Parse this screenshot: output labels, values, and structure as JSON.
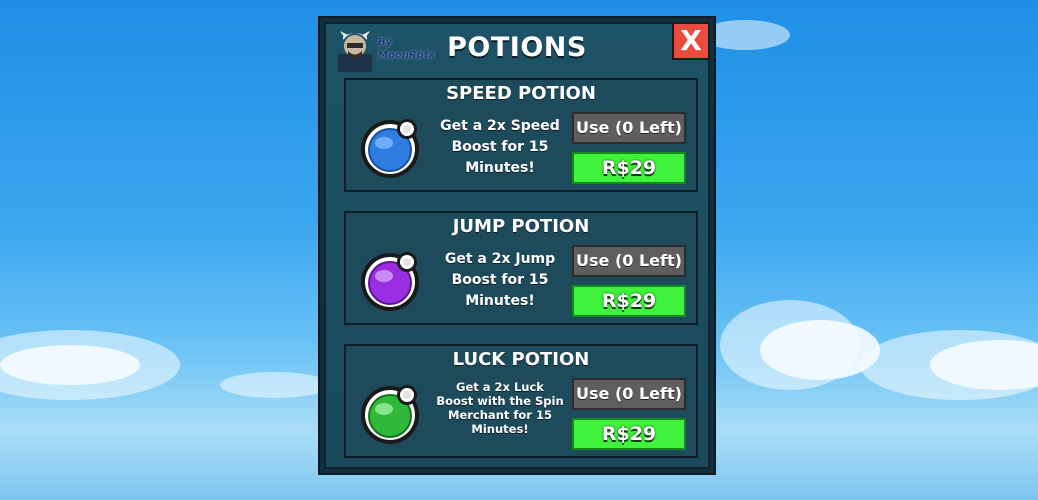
{
  "window": {
    "title": "POTIONS",
    "close_label": "X",
    "logo_line1": "By",
    "logo_line2": "MoonRbtx"
  },
  "potions": [
    {
      "name": "SPEED POTION",
      "description": "Get a 2x Speed Boost for 15 Minutes!",
      "use_label": "Use (0 Left)",
      "price_label": "R$29",
      "icon": "blue-potion-icon",
      "color": "#2f7de0"
    },
    {
      "name": "JUMP POTION",
      "description": "Get a 2x Jump Boost for 15 Minutes!",
      "use_label": "Use (0 Left)",
      "price_label": "R$29",
      "icon": "purple-potion-icon",
      "color": "#9a2ee0"
    },
    {
      "name": "LUCK POTION",
      "description": "Get a 2x Luck Boost with the Spin Merchant for 15 Minutes!",
      "use_label": "Use (0 Left)",
      "price_label": "R$29",
      "icon": "green-potion-icon",
      "color": "#2fb83a"
    }
  ],
  "colors": {
    "close": "#e94b3f",
    "buy": "#3ff23b",
    "use": "#5e5e5e"
  }
}
